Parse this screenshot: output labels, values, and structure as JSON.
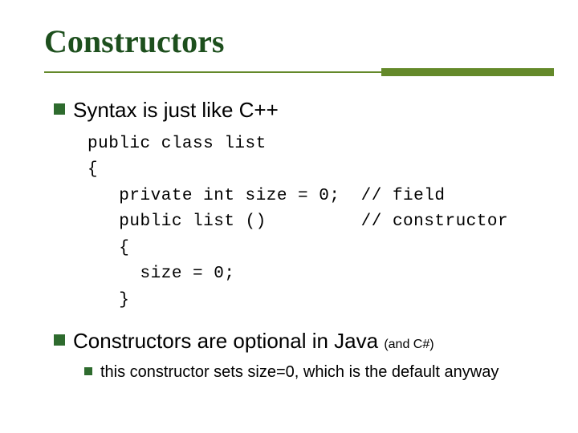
{
  "title": "Constructors",
  "bullets": [
    {
      "text": "Syntax is just like C++"
    },
    {
      "text": "Constructors are optional in Java ",
      "tail_small": "(and C#)"
    }
  ],
  "code": "public class list\n{\n   private int size = 0;  // field\n   public list ()         // constructor\n   {\n     size = 0;\n   }",
  "subbullets": [
    {
      "text": "this constructor sets size=0, which is the default anyway"
    }
  ]
}
